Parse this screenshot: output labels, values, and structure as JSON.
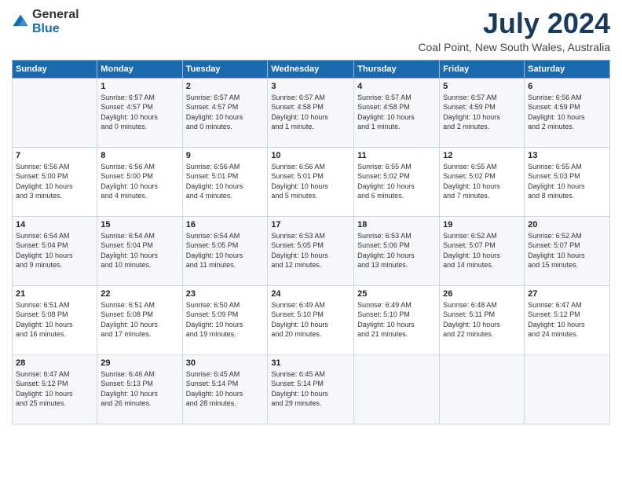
{
  "header": {
    "logo_general": "General",
    "logo_blue": "Blue",
    "month": "July 2024",
    "location": "Coal Point, New South Wales, Australia"
  },
  "calendar": {
    "days_of_week": [
      "Sunday",
      "Monday",
      "Tuesday",
      "Wednesday",
      "Thursday",
      "Friday",
      "Saturday"
    ],
    "weeks": [
      [
        {
          "day": "",
          "info": ""
        },
        {
          "day": "1",
          "info": "Sunrise: 6:57 AM\nSunset: 4:57 PM\nDaylight: 10 hours\nand 0 minutes."
        },
        {
          "day": "2",
          "info": "Sunrise: 6:57 AM\nSunset: 4:57 PM\nDaylight: 10 hours\nand 0 minutes."
        },
        {
          "day": "3",
          "info": "Sunrise: 6:57 AM\nSunset: 4:58 PM\nDaylight: 10 hours\nand 1 minute."
        },
        {
          "day": "4",
          "info": "Sunrise: 6:57 AM\nSunset: 4:58 PM\nDaylight: 10 hours\nand 1 minute."
        },
        {
          "day": "5",
          "info": "Sunrise: 6:57 AM\nSunset: 4:59 PM\nDaylight: 10 hours\nand 2 minutes."
        },
        {
          "day": "6",
          "info": "Sunrise: 6:56 AM\nSunset: 4:59 PM\nDaylight: 10 hours\nand 2 minutes."
        }
      ],
      [
        {
          "day": "7",
          "info": "Sunrise: 6:56 AM\nSunset: 5:00 PM\nDaylight: 10 hours\nand 3 minutes."
        },
        {
          "day": "8",
          "info": "Sunrise: 6:56 AM\nSunset: 5:00 PM\nDaylight: 10 hours\nand 4 minutes."
        },
        {
          "day": "9",
          "info": "Sunrise: 6:56 AM\nSunset: 5:01 PM\nDaylight: 10 hours\nand 4 minutes."
        },
        {
          "day": "10",
          "info": "Sunrise: 6:56 AM\nSunset: 5:01 PM\nDaylight: 10 hours\nand 5 minutes."
        },
        {
          "day": "11",
          "info": "Sunrise: 6:55 AM\nSunset: 5:02 PM\nDaylight: 10 hours\nand 6 minutes."
        },
        {
          "day": "12",
          "info": "Sunrise: 6:55 AM\nSunset: 5:02 PM\nDaylight: 10 hours\nand 7 minutes."
        },
        {
          "day": "13",
          "info": "Sunrise: 6:55 AM\nSunset: 5:03 PM\nDaylight: 10 hours\nand 8 minutes."
        }
      ],
      [
        {
          "day": "14",
          "info": "Sunrise: 6:54 AM\nSunset: 5:04 PM\nDaylight: 10 hours\nand 9 minutes."
        },
        {
          "day": "15",
          "info": "Sunrise: 6:54 AM\nSunset: 5:04 PM\nDaylight: 10 hours\nand 10 minutes."
        },
        {
          "day": "16",
          "info": "Sunrise: 6:54 AM\nSunset: 5:05 PM\nDaylight: 10 hours\nand 11 minutes."
        },
        {
          "day": "17",
          "info": "Sunrise: 6:53 AM\nSunset: 5:05 PM\nDaylight: 10 hours\nand 12 minutes."
        },
        {
          "day": "18",
          "info": "Sunrise: 6:53 AM\nSunset: 5:06 PM\nDaylight: 10 hours\nand 13 minutes."
        },
        {
          "day": "19",
          "info": "Sunrise: 6:52 AM\nSunset: 5:07 PM\nDaylight: 10 hours\nand 14 minutes."
        },
        {
          "day": "20",
          "info": "Sunrise: 6:52 AM\nSunset: 5:07 PM\nDaylight: 10 hours\nand 15 minutes."
        }
      ],
      [
        {
          "day": "21",
          "info": "Sunrise: 6:51 AM\nSunset: 5:08 PM\nDaylight: 10 hours\nand 16 minutes."
        },
        {
          "day": "22",
          "info": "Sunrise: 6:51 AM\nSunset: 5:08 PM\nDaylight: 10 hours\nand 17 minutes."
        },
        {
          "day": "23",
          "info": "Sunrise: 6:50 AM\nSunset: 5:09 PM\nDaylight: 10 hours\nand 19 minutes."
        },
        {
          "day": "24",
          "info": "Sunrise: 6:49 AM\nSunset: 5:10 PM\nDaylight: 10 hours\nand 20 minutes."
        },
        {
          "day": "25",
          "info": "Sunrise: 6:49 AM\nSunset: 5:10 PM\nDaylight: 10 hours\nand 21 minutes."
        },
        {
          "day": "26",
          "info": "Sunrise: 6:48 AM\nSunset: 5:11 PM\nDaylight: 10 hours\nand 22 minutes."
        },
        {
          "day": "27",
          "info": "Sunrise: 6:47 AM\nSunset: 5:12 PM\nDaylight: 10 hours\nand 24 minutes."
        }
      ],
      [
        {
          "day": "28",
          "info": "Sunrise: 6:47 AM\nSunset: 5:12 PM\nDaylight: 10 hours\nand 25 minutes."
        },
        {
          "day": "29",
          "info": "Sunrise: 6:46 AM\nSunset: 5:13 PM\nDaylight: 10 hours\nand 26 minutes."
        },
        {
          "day": "30",
          "info": "Sunrise: 6:45 AM\nSunset: 5:14 PM\nDaylight: 10 hours\nand 28 minutes."
        },
        {
          "day": "31",
          "info": "Sunrise: 6:45 AM\nSunset: 5:14 PM\nDaylight: 10 hours\nand 29 minutes."
        },
        {
          "day": "",
          "info": ""
        },
        {
          "day": "",
          "info": ""
        },
        {
          "day": "",
          "info": ""
        }
      ]
    ]
  }
}
